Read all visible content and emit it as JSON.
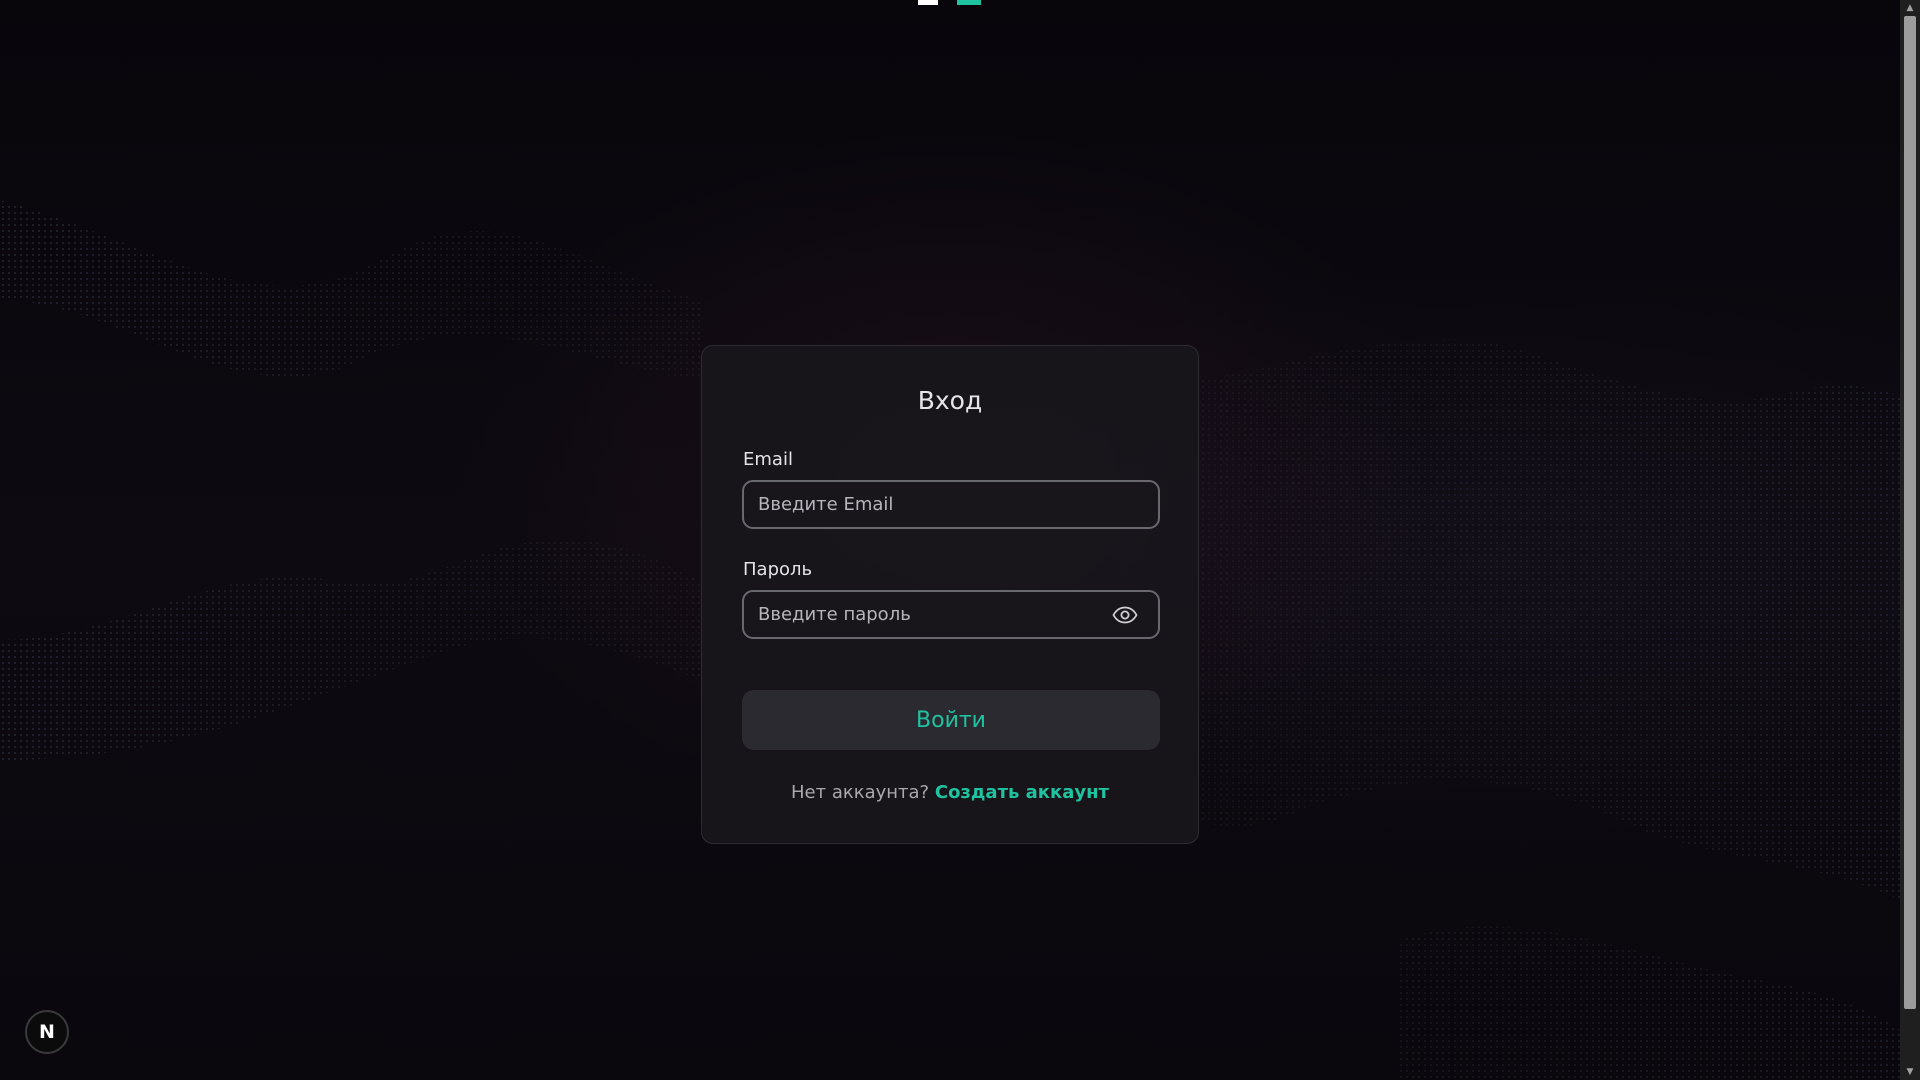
{
  "login": {
    "title": "Вход",
    "email_label": "Email",
    "email_placeholder": "Введите Email",
    "password_label": "Пароль",
    "password_placeholder": "Введите пароль",
    "submit_label": "Войти",
    "no_account_text": "Нет аккаунта?",
    "create_account_link": "Создать аккаунт"
  },
  "icons": {
    "password_toggle": "eye-icon",
    "dev_badge": "nextjs-logo-icon"
  },
  "badge": {
    "letter": "N"
  },
  "colors": {
    "accent": "#1fc3a0",
    "background": "#0a080d",
    "card": "#18161b",
    "input_border": "#6a686f",
    "button_bg": "#2b2a30"
  }
}
